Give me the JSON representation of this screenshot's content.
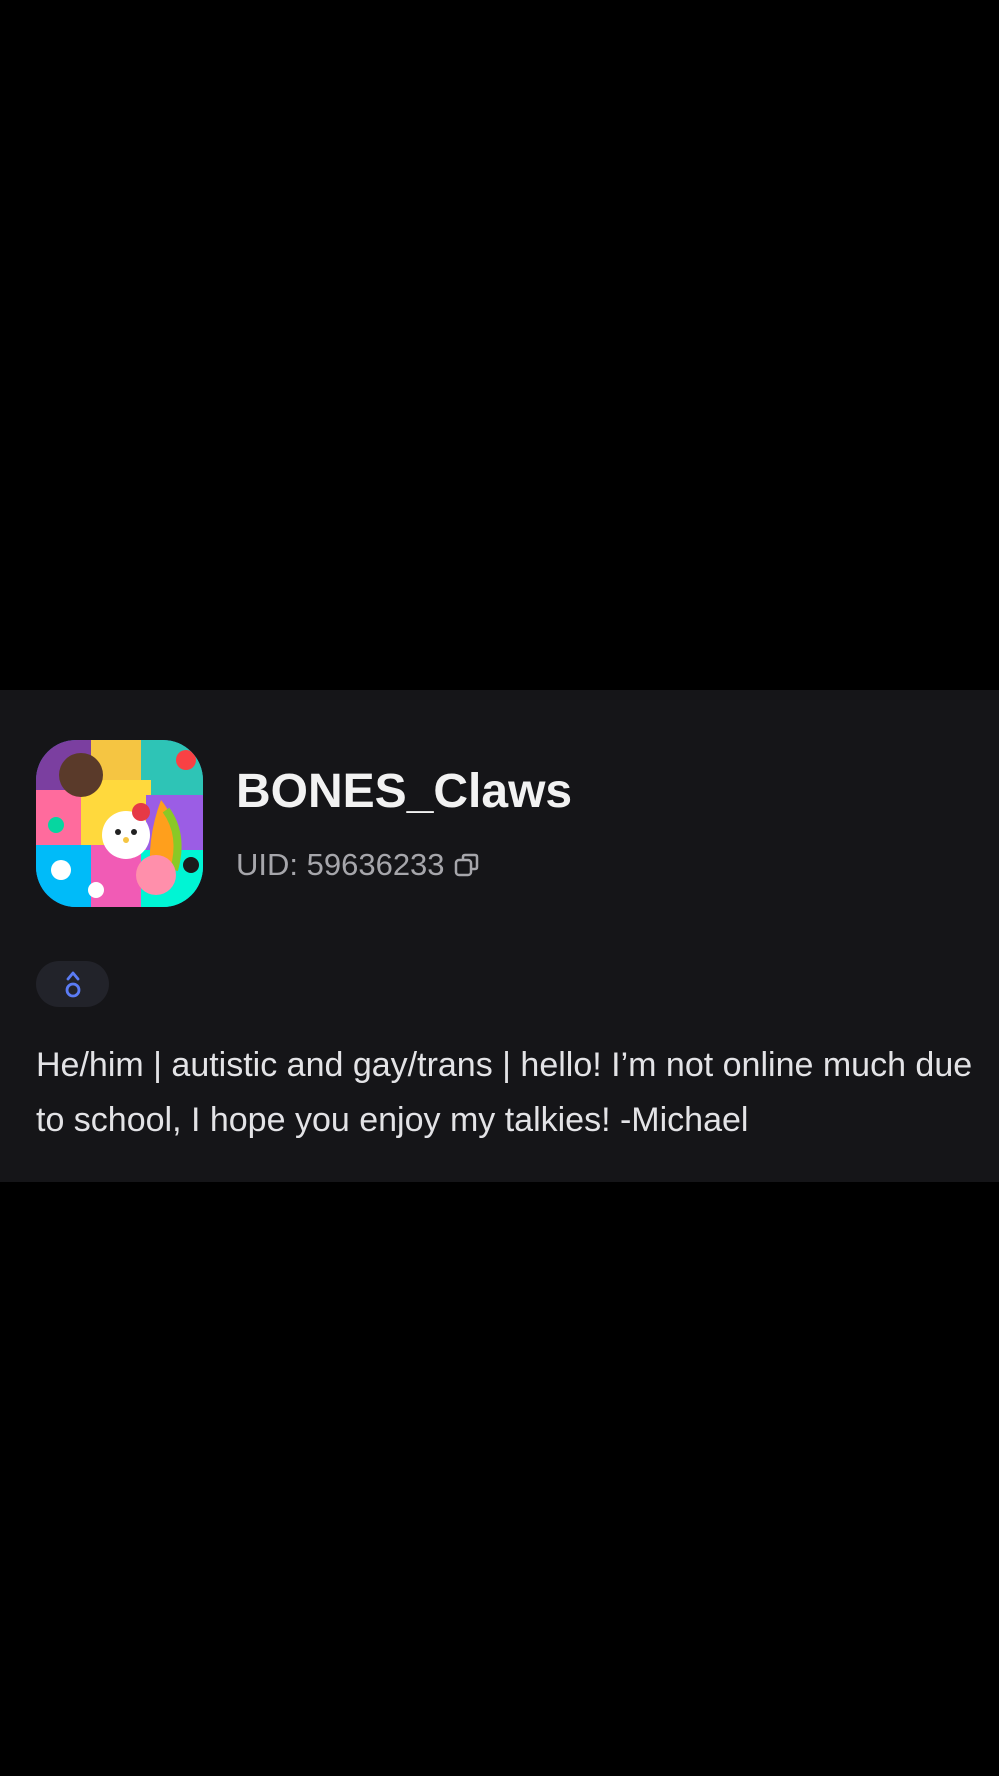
{
  "profile": {
    "username": "BONES_Claws",
    "uid_text": "UID: 59636233",
    "bio": "He/him | autistic and gay/trans | hello! I’m not online much due to school, I hope you enjoy my talkies! -Michael",
    "avatar_icon": "colorful-collage-avatar",
    "copy_icon": "copy-icon",
    "badge_icon": "male-symbol-icon"
  },
  "colors": {
    "background": "#000000",
    "card": "#151518",
    "badge_bg": "#22232a",
    "badge_accent": "#5b7cf5",
    "username": "#f2f2f2",
    "uid": "#a6a6ab",
    "bio": "#e3e3e6"
  }
}
